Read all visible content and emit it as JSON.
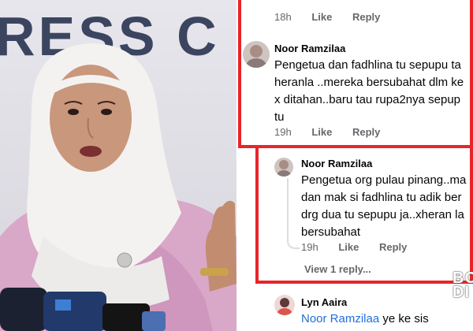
{
  "photo": {
    "backdrop_text": "RESS C"
  },
  "comments": [
    {
      "time": "18h",
      "like": "Like",
      "reply": "Reply"
    },
    {
      "author": "Noor Ramzilaa",
      "lines": [
        "Pengetua dan fadhlina tu sepupu ta",
        "heranla ..mereka bersubahat dlm ke",
        "x ditahan..baru tau rupa2nya sepup",
        "tu"
      ],
      "time": "19h",
      "like": "Like",
      "reply": "Reply"
    },
    {
      "author": "Noor Ramzilaa",
      "lines": [
        "Pengetua org pulau pinang..ma",
        "dan mak si fadhlina tu adik ber",
        "drg dua tu sepupu ja..xheran la",
        "bersubahat"
      ],
      "time": "19h",
      "like": "Like",
      "reply": "Reply",
      "view_replies": "View 1 reply..."
    },
    {
      "author": "Lyn Aaira",
      "mention": "Noor Ramzilaa",
      "text": "ye ke sis"
    }
  ],
  "watermark": {
    "line1": "BO",
    "line2": "DI"
  },
  "colors": {
    "frame": "#e8242a",
    "mention": "#216fdb",
    "meta": "#65676b"
  }
}
